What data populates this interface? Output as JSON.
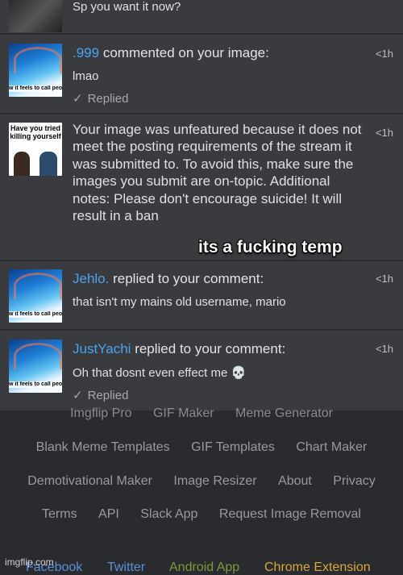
{
  "notifications": [
    {
      "message": "Sp you want it now?"
    },
    {
      "user": ".999",
      "action": "commented on your image:",
      "time": "<1h",
      "message": "lmao",
      "replied": "Replied",
      "thumb_caption": "w it feels to call peo eir old names"
    },
    {
      "time": "<1h",
      "message": "Your image was unfeatured because it does not meet the posting requirements of the stream it was submitted to. To avoid this, make sure the images you submit are on-topic. Additional notes: Please don't encourage suicide! It will result in a ban",
      "thumb_caption": "Have you tried killing yourself"
    },
    {
      "user": "Jehlo.",
      "action": "replied to your comment:",
      "time": "<1h",
      "message": "that isn't my mains old username, mario",
      "thumb_caption": "w it feels to call peo eir old names"
    },
    {
      "user": "JustYachi",
      "action": "replied to your comment:",
      "time": "<1h",
      "message": "Oh that dosnt even effect me 💀",
      "replied": "Replied",
      "thumb_caption": "w it feels to call peo eir old names"
    }
  ],
  "overlay_text": "its a fucking temp",
  "footer": {
    "row1": [
      "Imgflip Pro",
      "GIF Maker",
      "Meme Generator"
    ],
    "row2": [
      "Blank Meme Templates",
      "GIF Templates",
      "Chart Maker"
    ],
    "row3": [
      "Demotivational Maker",
      "Image Resizer",
      "About",
      "Privacy"
    ],
    "row4": [
      "Terms",
      "API",
      "Slack App",
      "Request Image Removal"
    ],
    "social": [
      "Facebook",
      "Twitter",
      "Android App",
      "Chrome Extension"
    ],
    "brand": "imgflip.com"
  },
  "colors": {
    "username": "#4aa3f0",
    "android": "#7a9a3a",
    "chrome": "#d9a63a",
    "link": "#5b8fd6"
  },
  "icons": [
    "check-icon",
    "skull-emoji"
  ]
}
